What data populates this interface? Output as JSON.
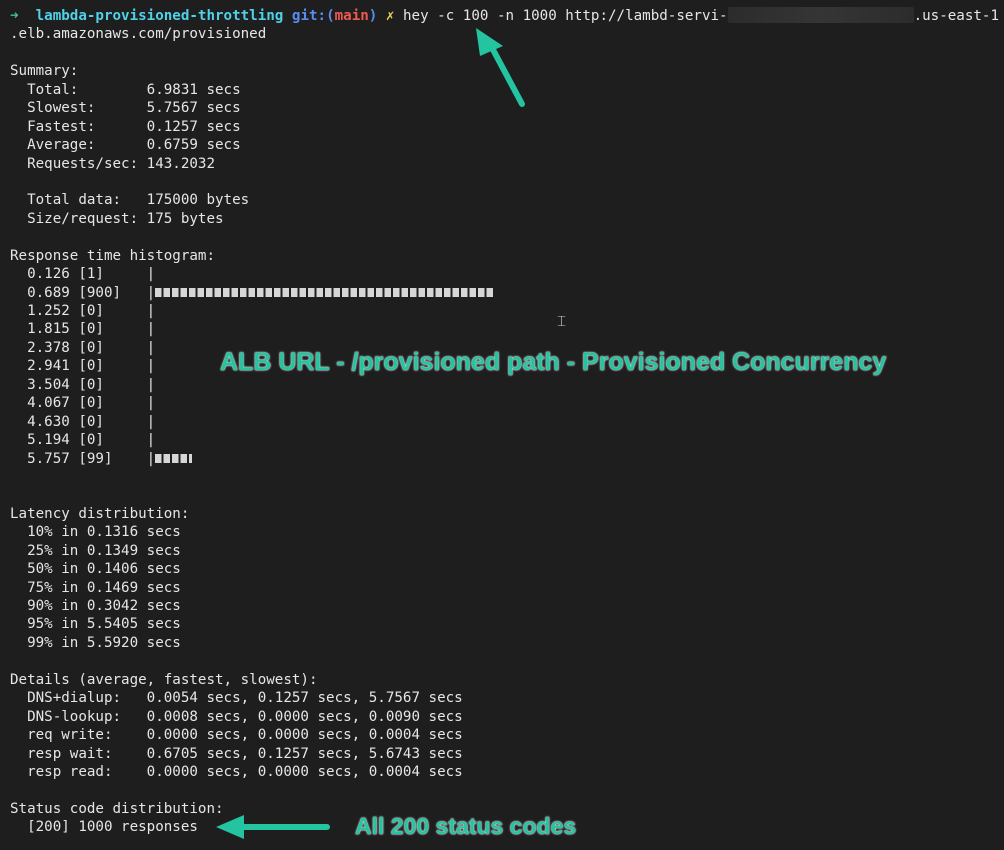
{
  "command": {
    "prompt_symbol": "➜",
    "directory": "lambda-provisioned-throttling",
    "git_label": "git:(",
    "branch": "main",
    "git_close": ")",
    "dirty_marker": "✗",
    "cmd_text": "hey -c 100 -n 1000 http://lambd-servi-",
    "url_suffix": ".us-east-1",
    "url_continuation": ".elb.amazonaws.com/provisioned"
  },
  "summary": {
    "heading": "Summary:",
    "lines": [
      "  Total:        6.9831 secs",
      "  Slowest:      5.7567 secs",
      "  Fastest:      0.1257 secs",
      "  Average:      0.6759 secs",
      "  Requests/sec: 143.2032"
    ],
    "data_lines": [
      "  Total data:   175000 bytes",
      "  Size/request: 175 bytes"
    ]
  },
  "histogram": {
    "heading": "Response time histogram:",
    "bins": [
      {
        "label": "  0.126 [1]     |",
        "count": 1
      },
      {
        "label": "  0.689 [900]   |",
        "count": 900
      },
      {
        "label": "  1.252 [0]     |",
        "count": 0
      },
      {
        "label": "  1.815 [0]     |",
        "count": 0
      },
      {
        "label": "  2.378 [0]     |",
        "count": 0
      },
      {
        "label": "  2.941 [0]     |",
        "count": 0
      },
      {
        "label": "  3.504 [0]     |",
        "count": 0
      },
      {
        "label": "  4.067 [0]     |",
        "count": 0
      },
      {
        "label": "  4.630 [0]     |",
        "count": 0
      },
      {
        "label": "  5.194 [0]     |",
        "count": 0
      },
      {
        "label": "  5.757 [99]    |",
        "count": 99
      }
    ]
  },
  "latency": {
    "heading": "Latency distribution:",
    "lines": [
      "  10% in 0.1316 secs",
      "  25% in 0.1349 secs",
      "  50% in 0.1406 secs",
      "  75% in 0.1469 secs",
      "  90% in 0.3042 secs",
      "  95% in 5.5405 secs",
      "  99% in 5.5920 secs"
    ]
  },
  "details": {
    "heading": "Details (average, fastest, slowest):",
    "lines": [
      "  DNS+dialup:   0.0054 secs, 0.1257 secs, 5.7567 secs",
      "  DNS-lookup:   0.0008 secs, 0.0000 secs, 0.0090 secs",
      "  req write:    0.0000 secs, 0.0000 secs, 0.0004 secs",
      "  resp wait:    0.6705 secs, 0.1257 secs, 5.6743 secs",
      "  resp read:    0.0000 secs, 0.0000 secs, 0.0004 secs"
    ]
  },
  "status": {
    "heading": "Status code distribution:",
    "lines": [
      "  [200] 1000 responses"
    ]
  },
  "annotations": {
    "main": "ALB URL - /provisioned path - Provisioned Concurrency",
    "status": "All 200 status codes",
    "color": "#24c4a0"
  },
  "cursor_icon": "text-cursor-icon"
}
